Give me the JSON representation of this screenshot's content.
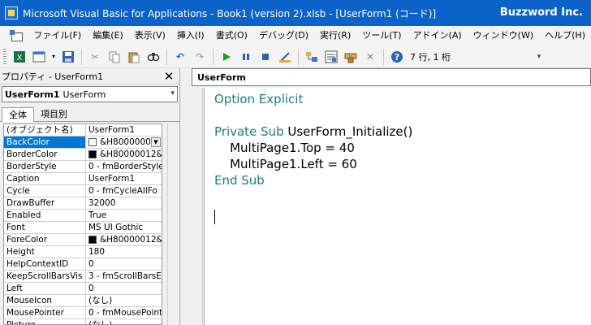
{
  "window": {
    "title": "Microsoft Visual Basic for Applications - Book1 (version 2).xlsb - [UserForm1 (コード)]",
    "brand": "Buzzword Inc."
  },
  "menu": {
    "items": [
      "ファイル(F)",
      "編集(E)",
      "表示(V)",
      "挿入(I)",
      "書式(O)",
      "デバッグ(D)",
      "実行(R)",
      "ツール(T)",
      "アドイン(A)",
      "ウィンドウ(W)",
      "ヘルプ(H)"
    ]
  },
  "toolbar": {
    "status": "7 行, 1 桁"
  },
  "properties": {
    "title": "プロパティ - UserForm1",
    "object_name": "UserForm1",
    "object_type": "UserForm",
    "tabs": [
      "全体",
      "項目別"
    ],
    "rows": [
      {
        "name": "(オブジェクト名)",
        "value": "UserForm1"
      },
      {
        "name": "BackColor",
        "value": "&H8000000",
        "swatch": "#ffffff"
      },
      {
        "name": "BorderColor",
        "value": "&H80000012&",
        "swatch": "#000000"
      },
      {
        "name": "BorderStyle",
        "value": "0 - fmBorderStyle"
      },
      {
        "name": "Caption",
        "value": "UserForm1"
      },
      {
        "name": "Cycle",
        "value": "0 - fmCycleAllFo"
      },
      {
        "name": "DrawBuffer",
        "value": "32000"
      },
      {
        "name": "Enabled",
        "value": "True"
      },
      {
        "name": "Font",
        "value": "MS UI Gothic"
      },
      {
        "name": "ForeColor",
        "value": "&H80000012&",
        "swatch": "#000000"
      },
      {
        "name": "Height",
        "value": "180"
      },
      {
        "name": "HelpContextID",
        "value": "0"
      },
      {
        "name": "KeepScrollBarsVis",
        "value": "3 - fmScrollBarsE"
      },
      {
        "name": "Left",
        "value": "0"
      },
      {
        "name": "MouseIcon",
        "value": "(なし)"
      },
      {
        "name": "MousePointer",
        "value": "0 - fmMousePoint"
      },
      {
        "name": "Picture",
        "value": "(なし)"
      }
    ]
  },
  "code_window": {
    "title": "UserForm",
    "lines": [
      {
        "parts": [
          {
            "text": "Option Explicit",
            "kw": true
          }
        ]
      },
      {
        "parts": []
      },
      {
        "parts": [
          {
            "text": "Private Sub ",
            "kw": true
          },
          {
            "text": "UserForm_Initialize()",
            "kw": false
          }
        ]
      },
      {
        "parts": [
          {
            "text": "    MultiPage1.Top = 40",
            "kw": false
          }
        ]
      },
      {
        "parts": [
          {
            "text": "    MultiPage1.Left = 60",
            "kw": false
          }
        ]
      },
      {
        "parts": [
          {
            "text": "End Sub",
            "kw": true
          }
        ]
      }
    ]
  },
  "colors": {
    "titlebar": "#0b62c9",
    "keyword": "#1a7f76",
    "selection": "#0078d7"
  }
}
